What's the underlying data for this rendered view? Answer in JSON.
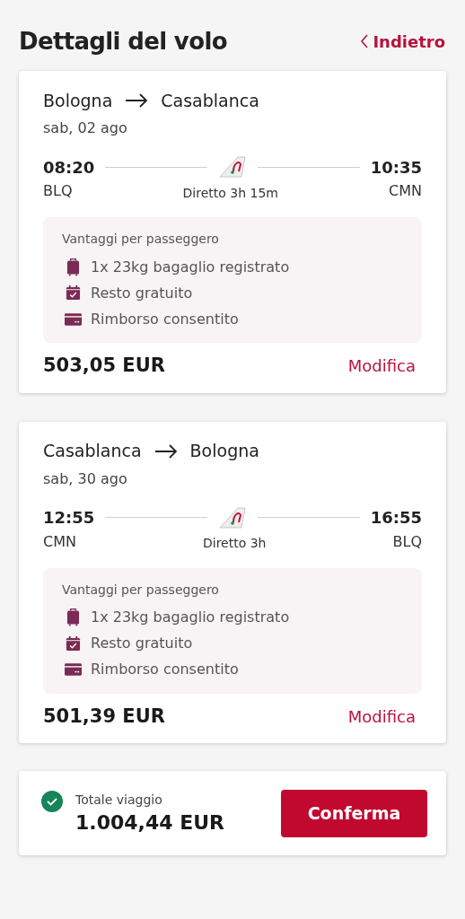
{
  "header": {
    "title": "Dettagli del volo",
    "back_link": "Indietro"
  },
  "flights": [
    {
      "from": "Bologna",
      "to": "Casablanca",
      "date": "sab, 02 ago",
      "departure_time": "08:20",
      "departure_code": "BLQ",
      "arrival_time": "10:35",
      "arrival_code": "CMN",
      "duration": "Diretto 3h 15m",
      "benefits_title": "Vantaggi per passeggero",
      "benefits": [
        {
          "kind": "baggage",
          "label": "1x 23kg bagaglio registrato"
        },
        {
          "kind": "calendar",
          "label": "Resto gratuito"
        },
        {
          "kind": "card",
          "label": "Rimborso consentito"
        }
      ],
      "price": "503,05 EUR",
      "edit_link": "Modifica"
    },
    {
      "from": "Casablanca",
      "to": "Bologna",
      "date": "sab, 30 ago",
      "departure_time": "12:55",
      "departure_code": "CMN",
      "arrival_time": "16:55",
      "arrival_code": "BLQ",
      "duration": "Diretto 3h",
      "benefits_title": "Vantaggi per passeggero",
      "benefits": [
        {
          "kind": "baggage",
          "label": "1x 23kg bagaglio registrato"
        },
        {
          "kind": "calendar",
          "label": "Resto gratuito"
        },
        {
          "kind": "card",
          "label": "Rimborso consentito"
        }
      ],
      "price": "501,39 EUR",
      "edit_link": "Modifica"
    }
  ],
  "total": {
    "label": "Totale viaggio",
    "amount": "1.004,44 EUR",
    "confirm_button": "Conferma"
  }
}
